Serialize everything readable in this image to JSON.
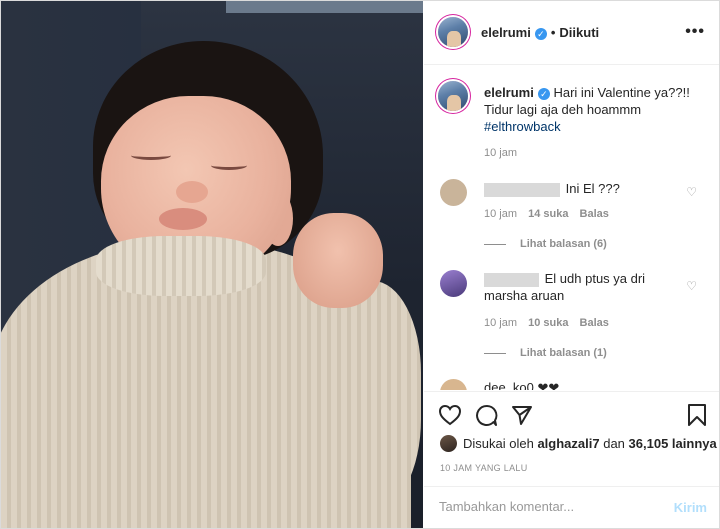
{
  "post_author": {
    "username": "elelrumi",
    "verified": true,
    "separator": "•",
    "follow_status": "Diikuti"
  },
  "caption": {
    "username": "elelrumi",
    "text": "Hari ini Valentine ya??!! Tidur lagi aja deh hoammm",
    "hashtag": "#elthrowback",
    "time": "10 jam"
  },
  "comments": [
    {
      "text": "Ini El ???",
      "time": "10 jam",
      "likes": "14 suka",
      "reply_label": "Balas",
      "view_replies": "Lihat balasan (6)"
    },
    {
      "text": "El udh ptus ya dri marsha aruan",
      "time": "10 jam",
      "likes": "10 suka",
      "reply_label": "Balas",
      "view_replies": "Lihat balasan (1)"
    },
    {
      "text": "dee_ko0 ❤❤"
    }
  ],
  "liked_by": {
    "prefix": "Disukai oleh",
    "user": "alghazali7",
    "connector": "dan",
    "others": "36,105 lainnya"
  },
  "time_ago": "10 JAM YANG LALU",
  "add_comment": {
    "placeholder": "Tambahkan komentar...",
    "post_label": "Kirim"
  },
  "more_icon": "more-options-icon",
  "colors": {
    "verified": "#3897f0",
    "hashtag": "#003569",
    "post_disabled": "#b2dffc",
    "muted": "#8e8e8e"
  }
}
